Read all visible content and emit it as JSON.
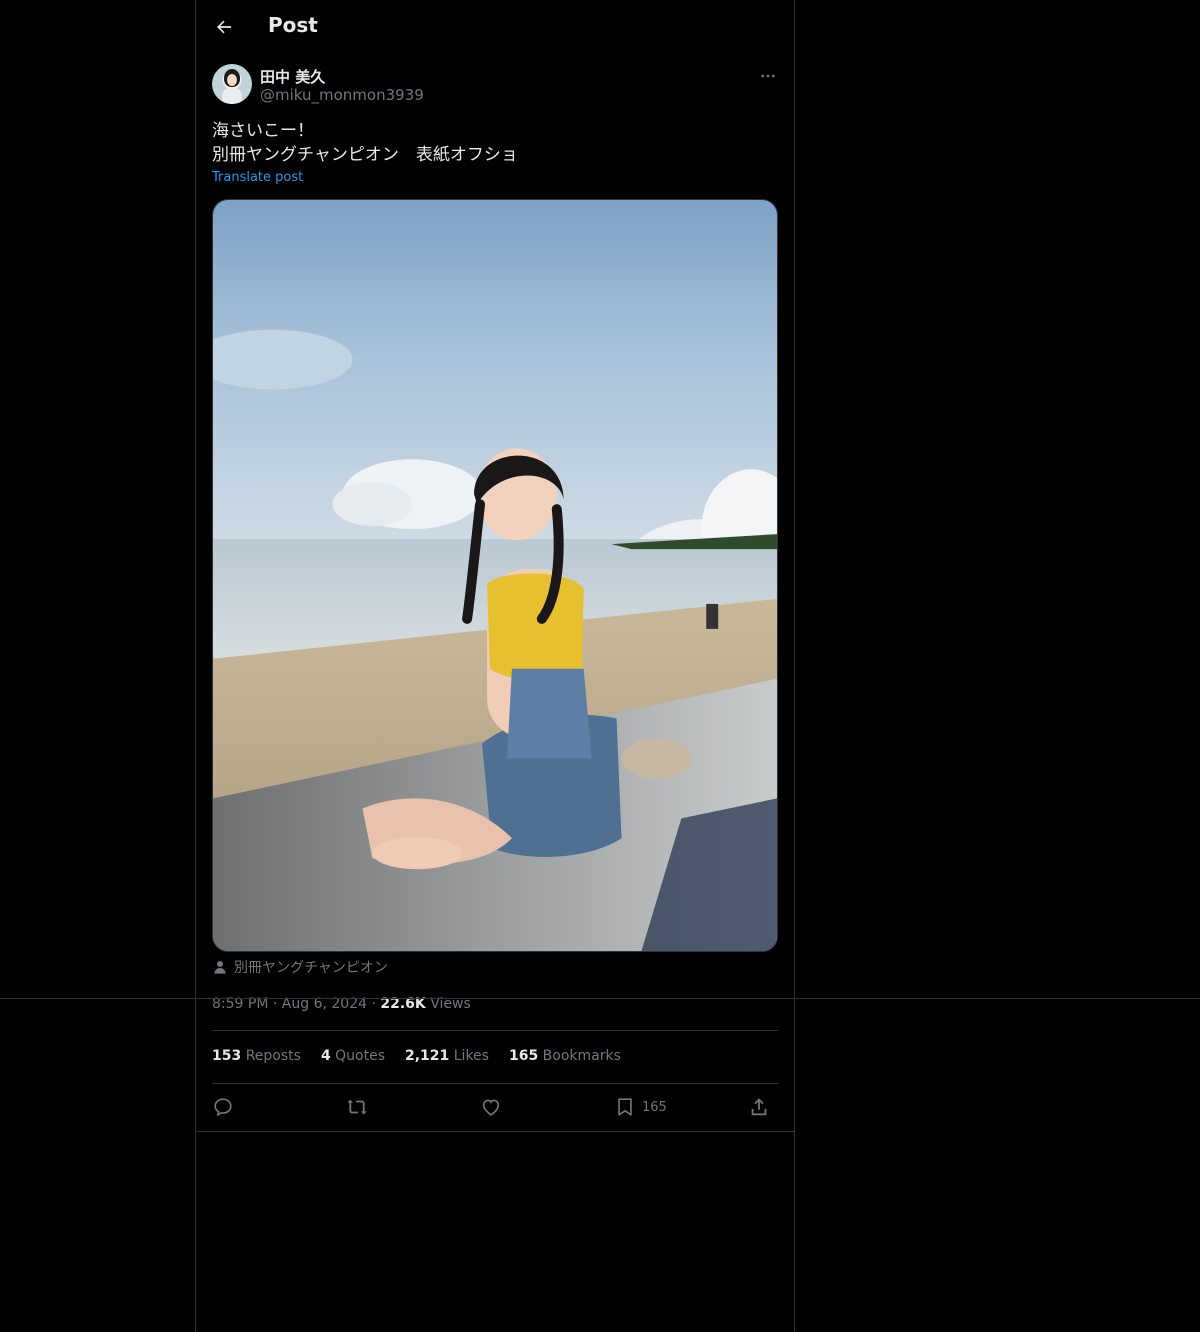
{
  "header": {
    "title": "Post"
  },
  "author": {
    "name": "田中 美久",
    "handle": "@miku_monmon3939"
  },
  "post": {
    "text_line1": "海さいこー！",
    "text_line2": "別冊ヤングチャンピオン　表紙オフショ",
    "translate_label": "Translate post",
    "tagged_user": "別冊ヤングチャンピオン"
  },
  "meta": {
    "time": "8:59 PM",
    "date": "Aug 6, 2024",
    "views_count": "22.6K",
    "views_label": "Views"
  },
  "stats": [
    {
      "count": "153",
      "label": "Reposts"
    },
    {
      "count": "4",
      "label": "Quotes"
    },
    {
      "count": "2,121",
      "label": "Likes"
    },
    {
      "count": "165",
      "label": "Bookmarks"
    }
  ],
  "actions": {
    "reply_icon": "reply-icon",
    "repost_icon": "repost-icon",
    "like_icon": "heart-icon",
    "bookmark_icon": "bookmark-icon",
    "bookmark_count": "165",
    "share_icon": "share-icon"
  },
  "colors": {
    "accent": "#1d9bf0",
    "muted": "#71767b",
    "border": "#2f3336",
    "background": "#000000"
  }
}
